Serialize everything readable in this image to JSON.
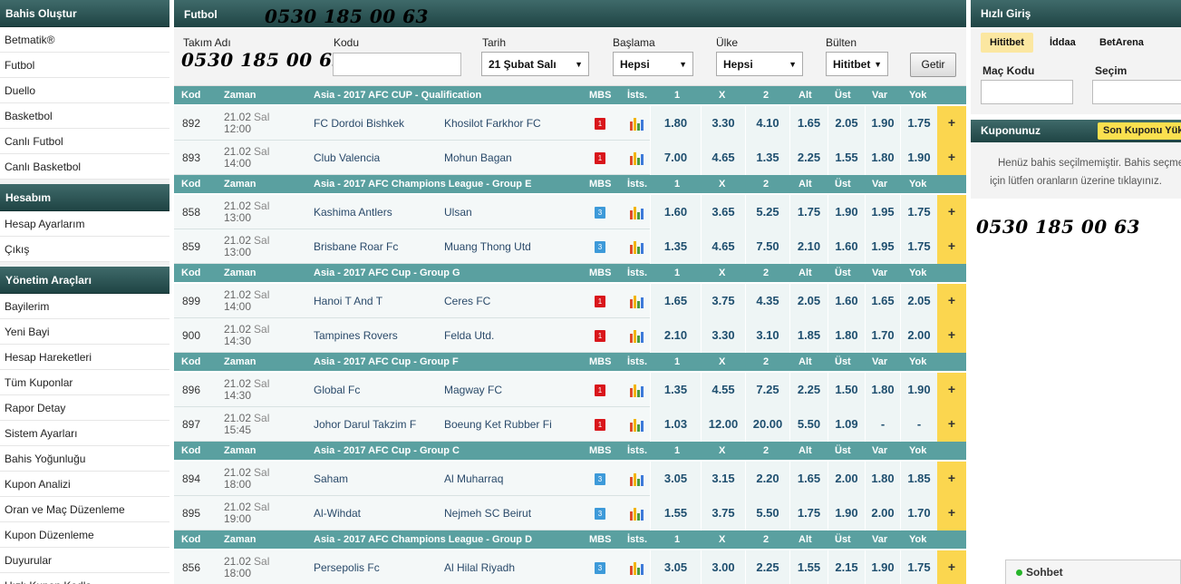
{
  "sidebar": {
    "sections": [
      {
        "title": "Bahis Oluştur",
        "items": [
          "Betmatik®",
          "Futbol",
          "Duello",
          "Basketbol",
          "Canlı Futbol",
          "Canlı Basketbol"
        ]
      },
      {
        "title": "Hesabım",
        "items": [
          "Hesap Ayarlarım",
          "Çıkış"
        ]
      },
      {
        "title": "Yönetim Araçları",
        "items": [
          "Bayilerim",
          "Yeni Bayi",
          "Hesap Hareketleri",
          "Tüm Kuponlar",
          "Rapor Detay",
          "Sistem Ayarları",
          "Bahis Yoğunluğu",
          "Kupon Analizi",
          "Oran ve Maç Düzenleme",
          "Kupon Düzenleme",
          "Duyurular",
          "Hızlı Kupon Kodla"
        ]
      }
    ]
  },
  "phone_overlay": "0530 185 00 63",
  "main": {
    "title": "Futbol",
    "filters": {
      "team_label": "Takım Adı",
      "code_label": "Kodu",
      "date_label": "Tarih",
      "date_value": "21 Şubat Salı",
      "start_label": "Başlama",
      "start_value": "Hepsi",
      "country_label": "Ülke",
      "country_value": "Hepsi",
      "bulletin_label": "Bülten",
      "bulletin_value": "Hititbet",
      "submit_label": "Getir"
    },
    "columns": {
      "kod": "Kod",
      "zaman": "Zaman",
      "mbs": "MBS",
      "ist": "İsts.",
      "o1": "1",
      "ox": "X",
      "o2": "2",
      "alt": "Alt",
      "ust": "Üst",
      "var": "Var",
      "yok": "Yok"
    },
    "groups": [
      {
        "league": "Asia - 2017 AFC CUP - Qualification",
        "matches": [
          {
            "kod": "892",
            "date": "21.02",
            "day": "Sal",
            "time": "12:00",
            "home": "FC Dordoi Bishkek",
            "away": "Khosilot Farkhor FC",
            "mbs": "1",
            "mbs_color": "red",
            "odds": [
              "1.80",
              "3.30",
              "4.10",
              "1.65",
              "2.05",
              "1.90",
              "1.75"
            ],
            "plus": "+"
          },
          {
            "kod": "893",
            "date": "21.02",
            "day": "Sal",
            "time": "14:00",
            "home": "Club Valencia",
            "away": "Mohun Bagan",
            "mbs": "1",
            "mbs_color": "red",
            "odds": [
              "7.00",
              "4.65",
              "1.35",
              "2.25",
              "1.55",
              "1.80",
              "1.90"
            ],
            "plus": "+"
          }
        ]
      },
      {
        "league": "Asia - 2017 AFC Champions League - Group E",
        "matches": [
          {
            "kod": "858",
            "date": "21.02",
            "day": "Sal",
            "time": "13:00",
            "home": "Kashima Antlers",
            "away": "Ulsan",
            "mbs": "3",
            "mbs_color": "blue",
            "odds": [
              "1.60",
              "3.65",
              "5.25",
              "1.75",
              "1.90",
              "1.95",
              "1.75"
            ],
            "plus": "+"
          },
          {
            "kod": "859",
            "date": "21.02",
            "day": "Sal",
            "time": "13:00",
            "home": "Brisbane Roar Fc",
            "away": "Muang Thong Utd",
            "mbs": "3",
            "mbs_color": "blue",
            "odds": [
              "1.35",
              "4.65",
              "7.50",
              "2.10",
              "1.60",
              "1.95",
              "1.75"
            ],
            "plus": "+"
          }
        ]
      },
      {
        "league": "Asia - 2017 AFC Cup - Group G",
        "matches": [
          {
            "kod": "899",
            "date": "21.02",
            "day": "Sal",
            "time": "14:00",
            "home": "Hanoi T And T",
            "away": "Ceres FC",
            "mbs": "1",
            "mbs_color": "red",
            "odds": [
              "1.65",
              "3.75",
              "4.35",
              "2.05",
              "1.60",
              "1.65",
              "2.05"
            ],
            "plus": "+"
          },
          {
            "kod": "900",
            "date": "21.02",
            "day": "Sal",
            "time": "14:30",
            "home": "Tampines Rovers",
            "away": "Felda Utd.",
            "mbs": "1",
            "mbs_color": "red",
            "odds": [
              "2.10",
              "3.30",
              "3.10",
              "1.85",
              "1.80",
              "1.70",
              "2.00"
            ],
            "plus": "+"
          }
        ]
      },
      {
        "league": "Asia - 2017 AFC Cup - Group F",
        "matches": [
          {
            "kod": "896",
            "date": "21.02",
            "day": "Sal",
            "time": "14:30",
            "home": "Global Fc",
            "away": "Magway FC",
            "mbs": "1",
            "mbs_color": "red",
            "odds": [
              "1.35",
              "4.55",
              "7.25",
              "2.25",
              "1.50",
              "1.80",
              "1.90"
            ],
            "plus": "+"
          },
          {
            "kod": "897",
            "date": "21.02",
            "day": "Sal",
            "time": "15:45",
            "home": "Johor Darul Takzim F",
            "away": "Boeung Ket Rubber Fi",
            "mbs": "1",
            "mbs_color": "red",
            "odds": [
              "1.03",
              "12.00",
              "20.00",
              "5.50",
              "1.09",
              "-",
              "-"
            ],
            "plus": "+"
          }
        ]
      },
      {
        "league": "Asia - 2017 AFC Cup - Group C",
        "matches": [
          {
            "kod": "894",
            "date": "21.02",
            "day": "Sal",
            "time": "18:00",
            "home": "Saham",
            "away": "Al Muharraq",
            "mbs": "3",
            "mbs_color": "blue",
            "odds": [
              "3.05",
              "3.15",
              "2.20",
              "1.65",
              "2.00",
              "1.80",
              "1.85"
            ],
            "plus": "+"
          },
          {
            "kod": "895",
            "date": "21.02",
            "day": "Sal",
            "time": "19:00",
            "home": "Al-Wihdat",
            "away": "Nejmeh SC Beirut",
            "mbs": "3",
            "mbs_color": "blue",
            "odds": [
              "1.55",
              "3.75",
              "5.50",
              "1.75",
              "1.90",
              "2.00",
              "1.70"
            ],
            "plus": "+"
          }
        ]
      },
      {
        "league": "Asia - 2017 AFC Champions League - Group D",
        "matches": [
          {
            "kod": "856",
            "date": "21.02",
            "day": "Sal",
            "time": "18:00",
            "home": "Persepolis Fc",
            "away": "Al Hilal Riyadh",
            "mbs": "3",
            "mbs_color": "blue",
            "odds": [
              "3.05",
              "3.00",
              "2.25",
              "1.55",
              "2.15",
              "1.90",
              "1.75"
            ],
            "plus": "+"
          }
        ]
      }
    ]
  },
  "right": {
    "title": "Hızlı Giriş",
    "tabs": [
      "Hititbet",
      "İddaa",
      "BetArena"
    ],
    "code_label": "Maç Kodu",
    "choice_label": "Seçim",
    "coupon_title": "Kuponunuz",
    "last_coupon": "Son Kuponu Yükle",
    "empty_line1": "Henüz bahis seçilmemiştir. Bahis seçmek",
    "empty_line2": "için lütfen oranların üzerine tıklayınız."
  },
  "chat_label": "Sohbet",
  "colors": {
    "header": "#2f5757",
    "group_header": "#5aa0a0",
    "plus": "#fbd64f",
    "mbs_red": "#d9161b",
    "mbs_blue": "#3d9ad9"
  }
}
